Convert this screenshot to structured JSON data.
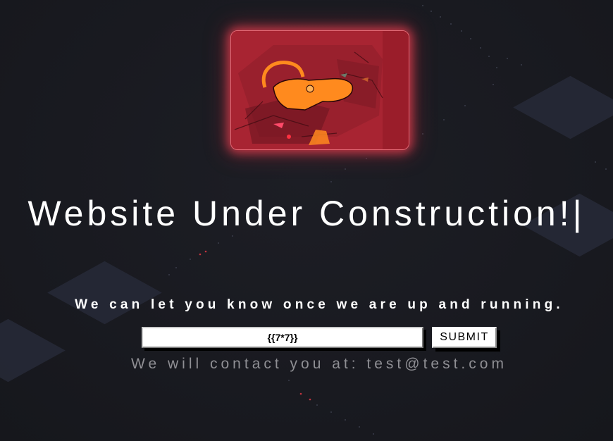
{
  "page": {
    "hero_image_alt": "hero-illustration",
    "title": "Website Under Construction!|",
    "subtitle": "We can let you know once we are up and running.",
    "form": {
      "email_value": "{{7*7}}",
      "submit_label": "SUBMIT"
    },
    "contact_message": "We will contact you at: test@test.com"
  },
  "colors": {
    "background": "#1a1b21",
    "accent_glow": "#e84050",
    "title_text": "#ffffff",
    "muted_text": "#8f8f94"
  }
}
